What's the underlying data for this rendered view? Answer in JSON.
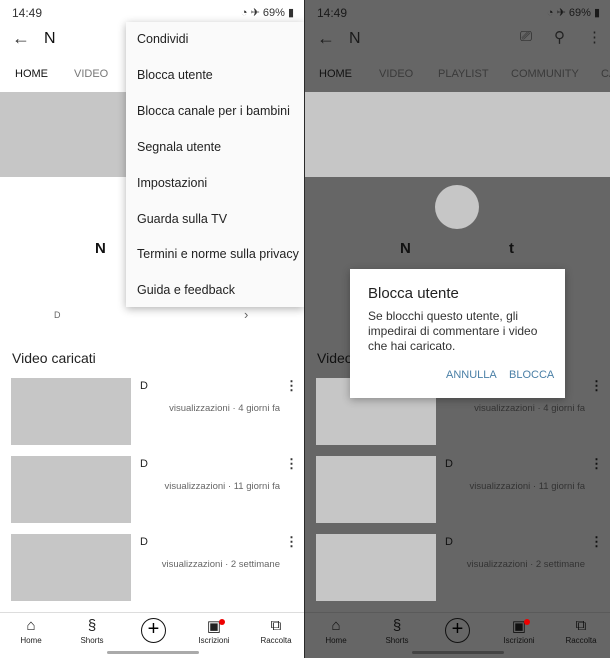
{
  "status": {
    "time": "14:49",
    "battery": "69%"
  },
  "channel": {
    "title": "N",
    "name_left": "N",
    "name_right_a": "N",
    "name_right_b": "t",
    "sub": "D",
    "section": "Video caricati"
  },
  "tabs": [
    "HOME",
    "VIDEO",
    "PLAYLIST",
    "COMMUNITY",
    "CA"
  ],
  "videos": [
    {
      "title": "D",
      "meta": "visualizzazioni · 4 giorni fa"
    },
    {
      "title": "D",
      "meta": "visualizzazioni · 11 giorni fa"
    },
    {
      "title": "D",
      "meta": "visualizzazioni · 2 settimane"
    }
  ],
  "nav": [
    "Home",
    "Shorts",
    "Iscrizioni",
    "Raccolta"
  ],
  "menu": [
    "Condividi",
    "Blocca utente",
    "Blocca canale per i bambini",
    "Segnala utente",
    "Impostazioni",
    "Guarda sulla TV",
    "Termini e norme sulla privacy",
    "Guida e feedback"
  ],
  "dialog": {
    "title": "Blocca utente",
    "body": "Se blocchi questo utente, gli impedirai di commentare i video che hai caricato.",
    "cancel": "ANNULLA",
    "confirm": "BLOCCA"
  },
  "colors": {
    "dialog_button": "#4a7fa6",
    "notification": "#e00000"
  }
}
